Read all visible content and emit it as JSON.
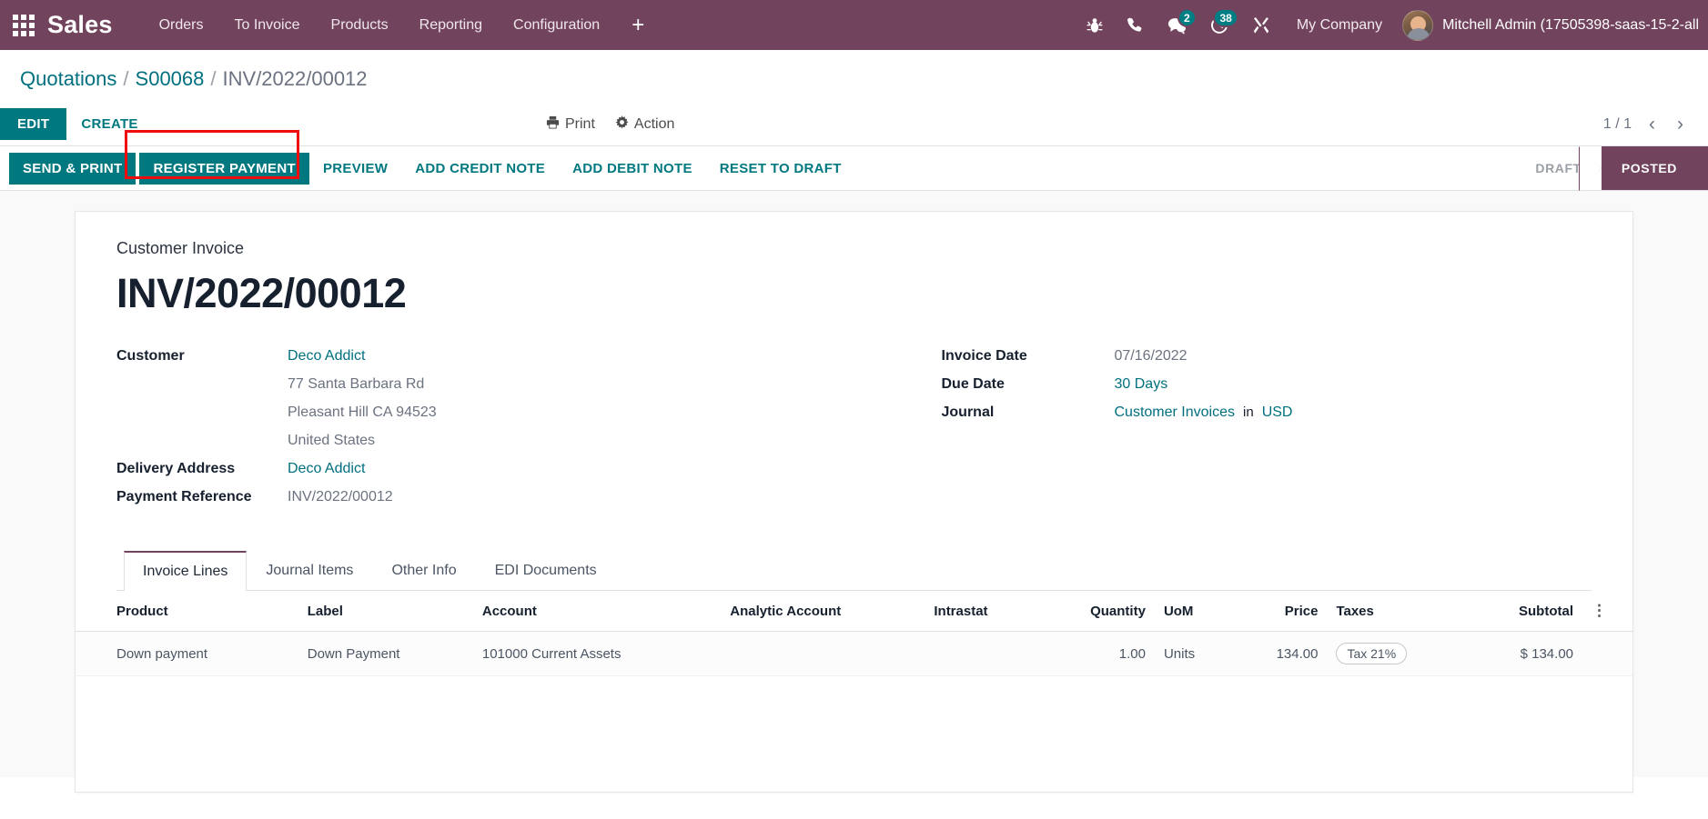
{
  "navbar": {
    "apps_icon": "apps-grid-icon",
    "brand": "Sales",
    "menu": [
      {
        "label": "Orders"
      },
      {
        "label": "To Invoice"
      },
      {
        "label": "Products"
      },
      {
        "label": "Reporting"
      },
      {
        "label": "Configuration"
      }
    ],
    "plus_label": "+",
    "sys_icons": [
      {
        "name": "bug-icon",
        "badge": null
      },
      {
        "name": "phone-icon",
        "badge": null
      },
      {
        "name": "messages-icon",
        "badge": "2"
      },
      {
        "name": "activities-clock-icon",
        "badge": "38"
      },
      {
        "name": "developer-tools-icon",
        "badge": null
      }
    ],
    "company": "My Company",
    "user": "Mitchell Admin (17505398-saas-15-2-all"
  },
  "breadcrumb": {
    "items": [
      {
        "label": "Quotations",
        "current": false
      },
      {
        "label": "S00068",
        "current": false
      },
      {
        "label": "INV/2022/00012",
        "current": true
      }
    ],
    "separator": "/"
  },
  "control_bar": {
    "edit_label": "EDIT",
    "create_label": "CREATE",
    "print_label": "Print",
    "action_label": "Action",
    "pager": "1 / 1",
    "prev_icon": "chevron-left-icon",
    "next_icon": "chevron-right-icon"
  },
  "statusbar": {
    "buttons": [
      {
        "label": "SEND & PRINT",
        "primary": true,
        "highlighted": false
      },
      {
        "label": "REGISTER PAYMENT",
        "primary": true,
        "highlighted": true
      },
      {
        "label": "PREVIEW",
        "primary": false,
        "highlighted": false
      },
      {
        "label": "ADD CREDIT NOTE",
        "primary": false,
        "highlighted": false
      },
      {
        "label": "ADD DEBIT NOTE",
        "primary": false,
        "highlighted": false
      },
      {
        "label": "RESET TO DRAFT",
        "primary": false,
        "highlighted": false
      }
    ],
    "stages": [
      {
        "label": "DRAFT",
        "active": false
      },
      {
        "label": "POSTED",
        "active": true
      }
    ],
    "highlight_color": "#f00c0c"
  },
  "form": {
    "doc_type": "Customer Invoice",
    "doc_title": "INV/2022/00012",
    "left": {
      "customer_label": "Customer",
      "customer_value": "Deco Addict",
      "address_lines": [
        "77 Santa Barbara Rd",
        "Pleasant Hill CA 94523",
        "United States"
      ],
      "delivery_label": "Delivery Address",
      "delivery_value": "Deco Addict",
      "payment_ref_label": "Payment Reference",
      "payment_ref_value": "INV/2022/00012"
    },
    "right": {
      "invoice_date_label": "Invoice Date",
      "invoice_date_value": "07/16/2022",
      "due_date_label": "Due Date",
      "due_date_value": "30 Days",
      "journal_label": "Journal",
      "journal_value": "Customer Invoices",
      "journal_in": "in",
      "currency_value": "USD"
    }
  },
  "tabs": [
    {
      "label": "Invoice Lines",
      "active": true
    },
    {
      "label": "Journal Items",
      "active": false
    },
    {
      "label": "Other Info",
      "active": false
    },
    {
      "label": "EDI Documents",
      "active": false
    }
  ],
  "lines_table": {
    "columns": [
      "Product",
      "Label",
      "Account",
      "Analytic Account",
      "Intrastat",
      "Quantity",
      "UoM",
      "Price",
      "Taxes",
      "Subtotal"
    ],
    "options_icon": "column-options-icon",
    "rows": [
      {
        "product": "Down payment",
        "label": "Down Payment",
        "account": "101000 Current Assets",
        "analytic_account": "",
        "intrastat": "",
        "quantity": "1.00",
        "uom": "Units",
        "price": "134.00",
        "taxes": "Tax 21%",
        "subtotal": "$ 134.00"
      }
    ]
  },
  "colors": {
    "brand_purple": "#71435c",
    "accent_teal": "#00787f",
    "link_teal": "#00707f"
  }
}
